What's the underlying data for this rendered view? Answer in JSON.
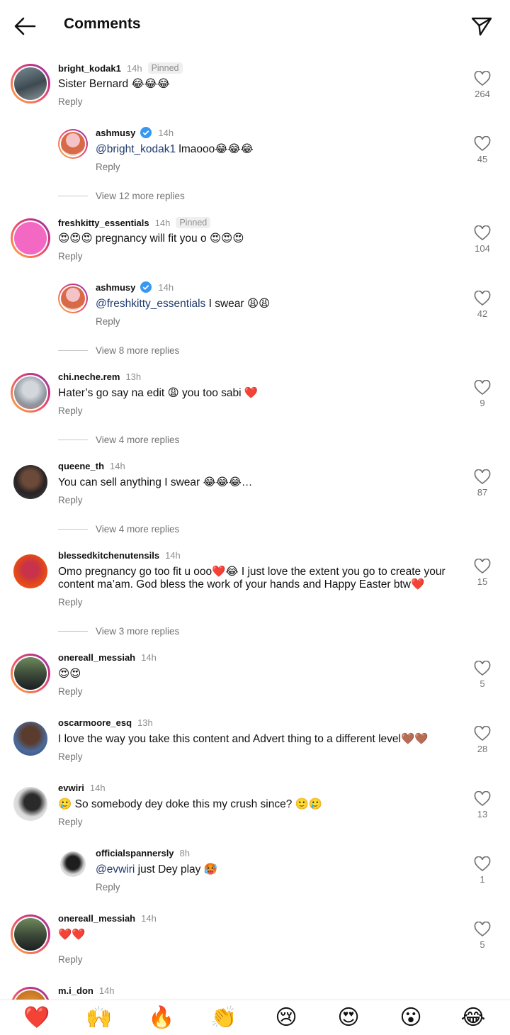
{
  "header": {
    "title": "Comments",
    "back_icon": "arrow-left-icon",
    "share_icon": "paper-plane-icon"
  },
  "reply_label": "Reply",
  "pinned_label": "Pinned",
  "comments": [
    {
      "user": "bright_kodak1",
      "time": "14h",
      "text": "Sister Bernard 😂😂😂",
      "likes": "264"
    },
    {
      "user": "ashmusy",
      "time": "14h",
      "mention": "@bright_kodak1",
      "text": " lmaooo😂😂😂",
      "likes": "45"
    },
    {
      "user": "freshkitty_essentials",
      "time": "14h",
      "text": "😍😍😍 pregnancy will fit you o 😍😍😍",
      "likes": "104"
    },
    {
      "user": "ashmusy",
      "time": "14h",
      "mention": "@freshkitty_essentials",
      "text": " I swear 😩😩",
      "likes": "42"
    },
    {
      "user": "chi.neche.rem",
      "time": "13h",
      "text": "Hater’s go say na edit 😩 you too sabi ❤️",
      "likes": "9"
    },
    {
      "user": "queene_th",
      "time": "14h",
      "text": "You can sell anything I swear 😂😂😂…",
      "likes": "87"
    },
    {
      "user": "blessedkitchenutensils",
      "time": "14h",
      "text": "Omo pregnancy go too fit u ooo❤️😂 I just love the extent you go to create your content ma’am. God bless the work of your hands and Happy Easter btw❤️",
      "likes": "15"
    },
    {
      "user": "onereall_messiah",
      "time": "14h",
      "text": "😍😍",
      "likes": "5"
    },
    {
      "user": "oscarmoore_esq",
      "time": "13h",
      "text": "I love the way you take this content and Advert thing to a different level🤎🤎",
      "likes": "28"
    },
    {
      "user": "evwiri",
      "time": "14h",
      "text": "🥲 So somebody dey doke this my crush since? 🙂🥲",
      "likes": "13"
    },
    {
      "user": "officialspannersly",
      "time": "8h",
      "mention": "@evwiri",
      "text": " just Dey play 🥵",
      "likes": "1"
    },
    {
      "user": "onereall_messiah",
      "time": "14h",
      "text": "❤️❤️",
      "likes": "5"
    },
    {
      "user": "m.i_don",
      "time": "14h"
    }
  ],
  "more_replies": [
    "View 12 more replies",
    "View 8 more replies",
    "View 4 more replies",
    "View 4 more replies",
    "View 3 more replies"
  ],
  "reactions": [
    "❤️",
    "🙌",
    "🔥",
    "👏",
    "😢",
    "😍",
    "😮",
    "😂"
  ],
  "colors": {
    "mention": "#1f3a6e",
    "secondary_text": "#737373",
    "story_ring": "#e1306c",
    "verified": "#3897f0"
  }
}
